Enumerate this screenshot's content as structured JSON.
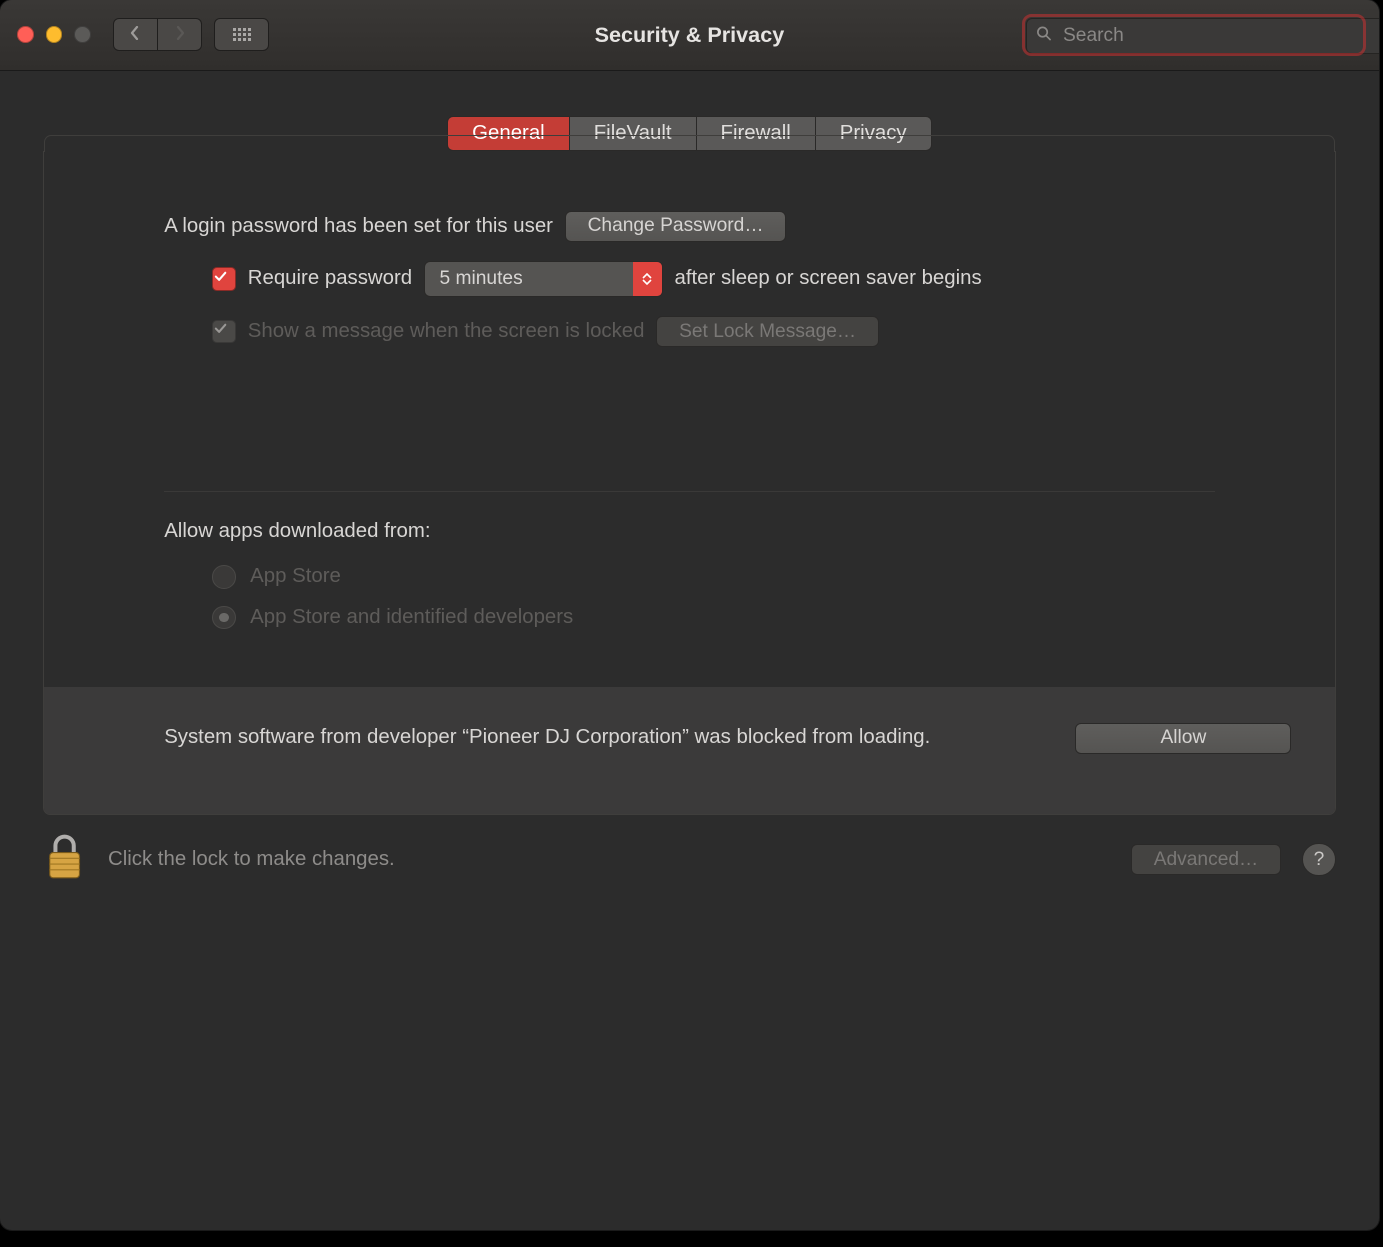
{
  "window": {
    "title": "Security & Privacy"
  },
  "search": {
    "placeholder": "Search"
  },
  "tabs": [
    {
      "label": "General",
      "selected": true
    },
    {
      "label": "FileVault",
      "selected": false
    },
    {
      "label": "Firewall",
      "selected": false
    },
    {
      "label": "Privacy",
      "selected": false
    }
  ],
  "general": {
    "login_password_set_text": "A login password has been set for this user",
    "change_password_button": "Change Password…",
    "require_password_checkbox_label": "Require password",
    "require_password_checked": true,
    "require_password_delay": "5 minutes",
    "require_password_suffix": "after sleep or screen saver begins",
    "show_lock_message_checkbox_label": "Show a message when the screen is locked",
    "show_lock_message_checked": true,
    "show_lock_message_disabled": true,
    "set_lock_message_button": "Set Lock Message…",
    "allow_apps_heading": "Allow apps downloaded from:",
    "allow_apps_options": [
      {
        "label": "App Store",
        "selected": false
      },
      {
        "label": "App Store and identified developers",
        "selected": true
      }
    ],
    "allow_apps_disabled": true,
    "blocked_software_notice": "System software from developer “Pioneer DJ Corporation” was blocked from loading.",
    "allow_button": "Allow"
  },
  "footer": {
    "lock_hint": "Click the lock to make changes.",
    "advanced_button": "Advanced…",
    "help_label": "?"
  }
}
